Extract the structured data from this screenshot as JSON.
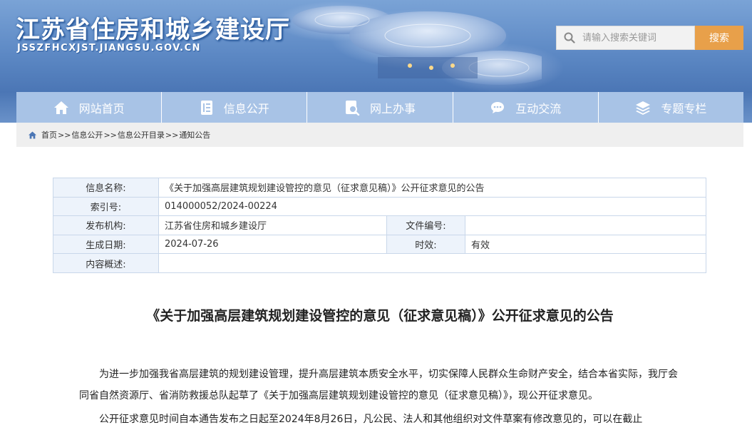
{
  "header": {
    "site_title": "江苏省住房和城乡建设厅",
    "site_domain": "JSSZFHCXJST.JIANGSU.GOV.CN",
    "search_placeholder": "请输入搜索关键词",
    "search_button": "搜索"
  },
  "nav": {
    "items": [
      {
        "label": "网站首页",
        "icon": "home-icon"
      },
      {
        "label": "信息公开",
        "icon": "document-icon"
      },
      {
        "label": "网上办事",
        "icon": "search-document-icon"
      },
      {
        "label": "互动交流",
        "icon": "chat-icon"
      },
      {
        "label": "专题专栏",
        "icon": "layers-icon"
      }
    ]
  },
  "breadcrumb": {
    "items": [
      "首页",
      "信息公开",
      "信息公开目录",
      "通知公告"
    ],
    "separator": ">>"
  },
  "meta": {
    "name_label": "信息名称:",
    "name_value": "《关于加强高层建筑规划建设管控的意见（征求意见稿）》公开征求意见的公告",
    "index_label": "索引号:",
    "index_value": "014000052/2024-00224",
    "publisher_label": "发布机构:",
    "publisher_value": "江苏省住房和城乡建设厅",
    "doc_no_label": "文件编号:",
    "doc_no_value": "",
    "date_label": "生成日期:",
    "date_value": "2024-07-26",
    "validity_label": "时效:",
    "validity_value": "有效",
    "summary_label": "内容概述:",
    "summary_value": ""
  },
  "article": {
    "title": "《关于加强高层建筑规划建设管控的意见（征求意见稿）》公开征求意见的公告",
    "paragraphs": [
      "为进一步加强我省高层建筑的规划建设管理，提升高层建筑本质安全水平，切实保障人民群众生命财产安全，结合本省实际，我厅会同省自然资源厅、省消防救援总队起草了《关于加强高层建筑规划建设管控的意见（征求意见稿）》，现公开征求意见。",
      "公开征求意见时间自本通告发布之日起至2024年8月26日，凡公民、法人和其他组织对文件草案有修改意见的，可以在截止"
    ]
  },
  "colors": {
    "nav_bg": "#a8c3e6",
    "search_button_bg": "#e8a04a",
    "table_label_bg": "#edf3fb",
    "table_border": "#c9d7ea"
  }
}
